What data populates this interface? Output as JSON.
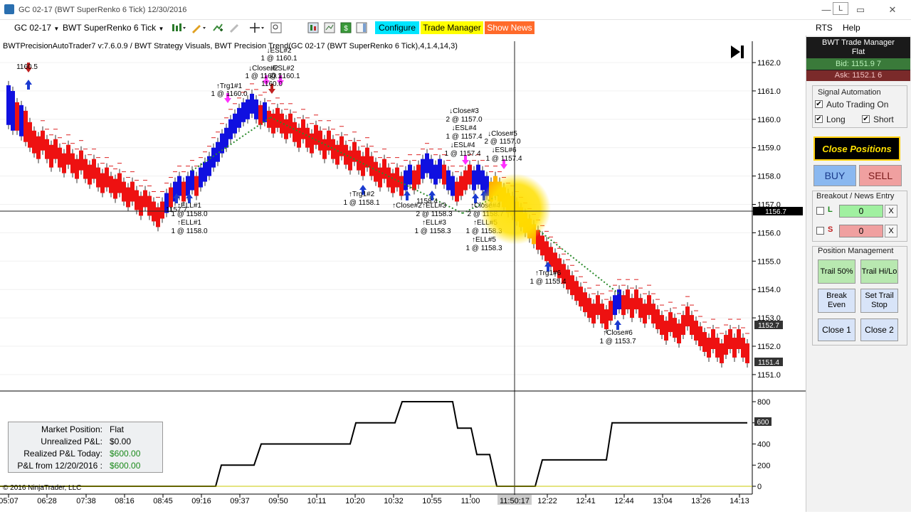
{
  "window": {
    "title": "GC 02-17 (BWT SuperRenko  6 Tick)  12/30/2016",
    "minimize_label": "—",
    "restore_label": "L",
    "maximize_label": "▭",
    "close_label": "✕"
  },
  "toolbar": {
    "instrument": "GC 02-17",
    "bar_type": "BWT SuperRenko  6 Tick",
    "configure_label": "Configure",
    "trade_manager_label": "Trade Manager",
    "show_news_label": "Show News",
    "colors": {
      "configure": "#00e5ff",
      "trade_manager": "#ffff00",
      "show_news": "#ff6a2a"
    }
  },
  "menu": {
    "rts_label": "RTS",
    "help_label": "Help"
  },
  "chart": {
    "indicator_caption": "BWTPrecisionAutoTrader7 v:7.6.0.9 / BWT Strategy Visuals, BWT Precision Trend(GC 02-17 (BWT SuperRenko  6 Tick),4,1.4,14,3)",
    "price_axis_labels": [
      "1162.0",
      "1161.0",
      "1160.0",
      "1159.0",
      "1158.0",
      "1157.0",
      "1156.0",
      "1155.0",
      "1154.0",
      "1153.0",
      "1152.0",
      "1151.0"
    ],
    "crosshair_price": "1156.7",
    "marker_price_1": "1152.7",
    "marker_price_2": "1151.4",
    "lower_axis_labels": [
      "800",
      "600",
      "400",
      "200",
      "0"
    ],
    "lower_marker": "600",
    "time_labels": [
      "05:07",
      "06:28",
      "07:38",
      "08:16",
      "08:45",
      "09:16",
      "09:37",
      "09:50",
      "10:11",
      "10:20",
      "10:32",
      "10:55",
      "11:00",
      "11:50:17",
      "12:22",
      "12:41",
      "12:44",
      "13:04",
      "13:26",
      "14:13"
    ],
    "copyright": "© 2016 NinjaTrader, LLC",
    "annotations": [
      {
        "text": "1160.5"
      },
      {
        "text": "↓ESL#2"
      },
      {
        "text": "1 @ 1160.1"
      },
      {
        "text": "↓Close#2"
      },
      {
        "text": "1 @ 1160.1"
      },
      {
        "text": "↓ESL#2"
      },
      {
        "text": "1 @ 1160.1"
      },
      {
        "text": "1160.0"
      },
      {
        "text": "↑Trg1#1"
      },
      {
        "text": "1 @ 1160.0"
      },
      {
        "text": "↓Close#3"
      },
      {
        "text": "2 @ 1157.0"
      },
      {
        "text": "↓ESL#4"
      },
      {
        "text": "1 @ 1157.4"
      },
      {
        "text": "↓ESL#4"
      },
      {
        "text": "1 @ 1157.4"
      },
      {
        "text": "↓Close#5"
      },
      {
        "text": "2 @ 1157.0"
      },
      {
        "text": "↓ESL#6"
      },
      {
        "text": "1 @ 1157.4"
      },
      {
        "text": "↑Trg1#2"
      },
      {
        "text": "1 @ 1158.1"
      },
      {
        "text": "1158.4"
      },
      {
        "text": "↑Close#2"
      },
      {
        "text": "↑ELL#3"
      },
      {
        "text": "2 @ 1158.3"
      },
      {
        "text": "↑ELL#3"
      },
      {
        "text": "1 @ 1158.3"
      },
      {
        "text": "↑Close#4"
      },
      {
        "text": "2 @ 1158.7"
      },
      {
        "text": "↑ELL#5"
      },
      {
        "text": "1 @ 1158.3"
      },
      {
        "text": "↑ELL#5"
      },
      {
        "text": "1 @ 1158.3"
      },
      {
        "text": "↑ELL#1"
      },
      {
        "text": "1 @ 1158.0"
      },
      {
        "text": "↑ELL#1"
      },
      {
        "text": "1 @ 1158.0"
      },
      {
        "text": "1157.7"
      },
      {
        "text": "↑Trg1#6"
      },
      {
        "text": "1 @ 1155.4"
      },
      {
        "text": "↑Close#6"
      },
      {
        "text": "1 @ 1153.7"
      }
    ],
    "colors": {
      "up_bar": "#1010e0",
      "down_bar": "#ee1111",
      "trend_line": "#2a8a2a",
      "equity_line": "#000000",
      "highlight": "#ffe000"
    }
  },
  "pnl": {
    "rows": [
      {
        "label": "Market Position:",
        "value": "Flat"
      },
      {
        "label": "Unrealized P&L:",
        "value": "$0.00"
      },
      {
        "label": "Realized P&L Today:",
        "value": "$600.00"
      },
      {
        "label": "P&L from 12/20/2016 :",
        "value": "$600.00"
      }
    ]
  },
  "side": {
    "header_title": "BWT Trade Manager",
    "header_status": "Flat",
    "bid": "Bid: 1151.9 7",
    "ask": "Ask: 1152.1 6",
    "signal_automation_title": "Signal Automation",
    "auto_trading_label": "Auto Trading On",
    "long_label": "Long",
    "short_label": "Short",
    "close_positions_label": "Close Positions",
    "buy_label": "BUY",
    "sell_label": "SELL",
    "breakout_title": "Breakout / News Entry",
    "l_label": "L",
    "s_label": "S",
    "l_value": "0",
    "s_value": "0",
    "x_label": "X",
    "position_mgmt_title": "Position Management",
    "trail50_label": "Trail 50%",
    "trail_hilo_label": "Trail Hi/Lo",
    "break_even_label": "Break Even",
    "set_trail_stop_label": "Set Trail Stop",
    "close1_label": "Close 1",
    "close2_label": "Close 2"
  }
}
